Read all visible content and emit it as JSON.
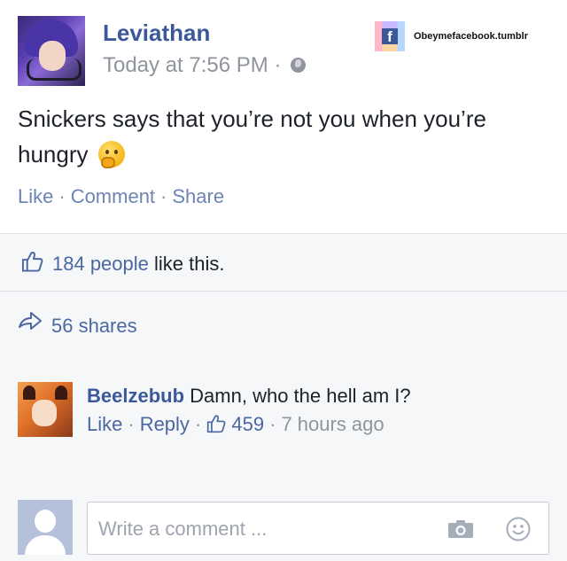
{
  "post": {
    "author": "Leviathan",
    "timestamp": "Today at 7:56 PM",
    "separator": "·",
    "privacy_icon": "globe-icon",
    "text": "Snickers says that you’re not you when you’re hungry",
    "emoji_icon": "thinking-face-icon",
    "watermark": "Obeymefacebook.tumblr",
    "actions": [
      "Like",
      "Comment",
      "Share"
    ]
  },
  "likes": {
    "count_text": "184 people",
    "suffix": "like this."
  },
  "shares": {
    "text": "56 shares"
  },
  "comment": {
    "author": "Beelzebub",
    "text": "Damn, who the hell am I?",
    "like_label": "Like",
    "reply_label": "Reply",
    "like_count": "459",
    "time": "7 hours ago"
  },
  "composer": {
    "placeholder": "Write a comment ..."
  },
  "colors": {
    "link": "#3b5998",
    "muted": "#90949c",
    "panel": "#f6f7f9"
  }
}
